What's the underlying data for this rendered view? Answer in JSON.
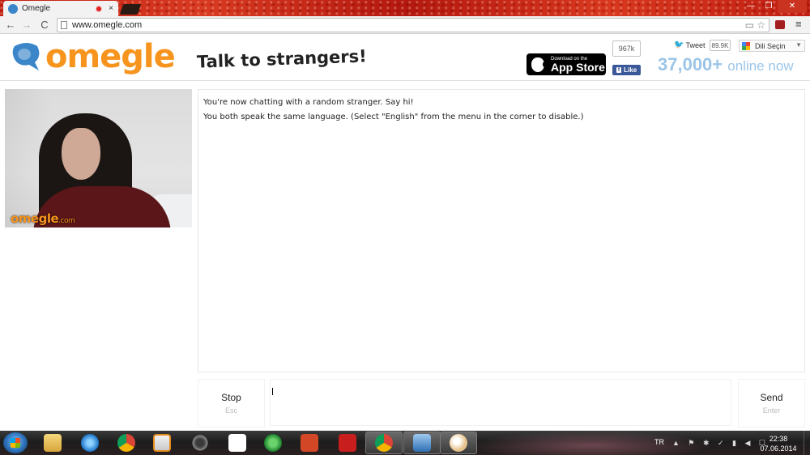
{
  "browser": {
    "tab_title": "Omegle",
    "tab_close": "×",
    "url": "www.omegle.com",
    "back": "←",
    "forward": "→",
    "reload": "C",
    "menu": "≡",
    "window_min": "—",
    "window_restore": "❐",
    "window_close": "✕",
    "omni_icons": "▭ ☆"
  },
  "header": {
    "logo": "omegle",
    "tagline": "Talk to strangers!",
    "appstore_small": "Download on the",
    "appstore_big": "App Store",
    "fb_count": "967k",
    "fb_like": "Like",
    "fb_f": "f",
    "tweet": "Tweet",
    "tweet_count": "89.9K",
    "language_select": "Dili Seçin",
    "language_arrow": "▼",
    "online_count": "37,000+",
    "online_suffix": "online now"
  },
  "video": {
    "watermark": "omegle",
    "watermark_suffix": ".com"
  },
  "chat": {
    "messages": [
      "You're now chatting with a random stranger. Say hi!",
      "You both speak the same language. (Select \"English\" from the menu in the corner to disable.)"
    ]
  },
  "controls": {
    "stop_label": "Stop",
    "stop_hint": "Esc",
    "send_label": "Send",
    "send_hint": "Enter",
    "message_value": ""
  },
  "taskbar": {
    "language": "TR",
    "tray": "▲ ⚑ ✱ ✓ ▮ ◀ ☐",
    "time": "22:38",
    "date": "07.06.2014"
  },
  "colors": {
    "omegle_orange": "#f7941e",
    "omegle_blue": "#3a86c8",
    "online_blue": "#9cc5e8"
  }
}
